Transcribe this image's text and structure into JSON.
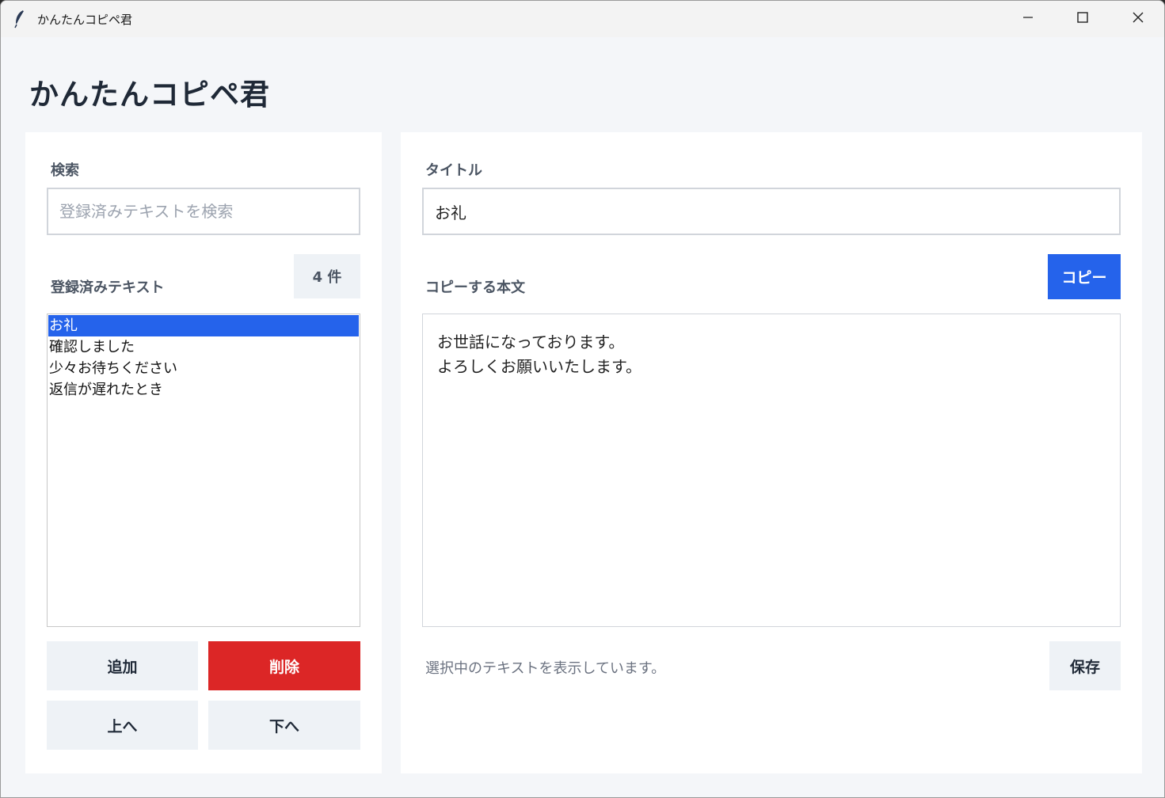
{
  "window": {
    "title": "かんたんコピペ君"
  },
  "app": {
    "heading": "かんたんコピペ君"
  },
  "left": {
    "search_label": "検索",
    "search_placeholder": "登録済みテキストを検索",
    "search_value": "",
    "list_label": "登録済みテキスト",
    "count_badge": "4 件",
    "items": [
      {
        "label": "お礼",
        "selected": true
      },
      {
        "label": "確認しました",
        "selected": false
      },
      {
        "label": "少々お待ちください",
        "selected": false
      },
      {
        "label": "返信が遅れたとき",
        "selected": false
      }
    ],
    "buttons": {
      "add": "追加",
      "delete": "削除",
      "up": "上へ",
      "down": "下へ"
    }
  },
  "right": {
    "title_label": "タイトル",
    "title_value": "お礼",
    "body_label": "コピーする本文",
    "copy_button": "コピー",
    "body_text": "お世話になっております。\nよろしくお願いいたします。",
    "status": "選択中のテキストを表示しています。",
    "save_button": "保存"
  },
  "colors": {
    "accent": "#2563eb",
    "danger": "#dc2626",
    "button_gray": "#eef2f6",
    "background": "#f4f6f9"
  },
  "icons": {
    "app": "feather-icon",
    "minimize": "minimize-icon",
    "maximize": "maximize-icon",
    "close": "close-icon"
  }
}
